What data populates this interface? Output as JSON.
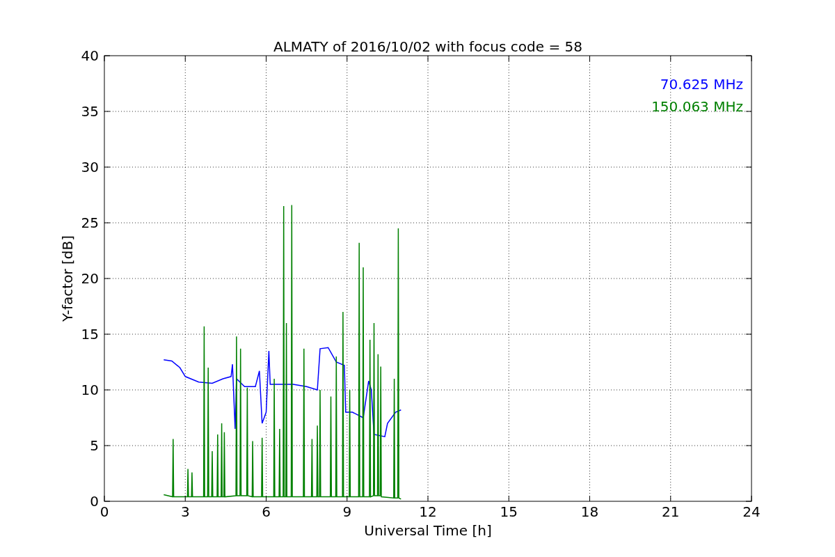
{
  "figure": {
    "chart_data": {
      "type": "line",
      "title": "ALMATY of 2016/10/02 with focus code = 58",
      "xlabel": "Universal Time [h]",
      "ylabel": "Y-factor [dB]",
      "xlim": [
        0,
        24
      ],
      "ylim": [
        0,
        40
      ],
      "xticks": [
        0,
        3,
        6,
        9,
        12,
        15,
        18,
        21,
        24
      ],
      "yticks": [
        0,
        5,
        10,
        15,
        20,
        25,
        30,
        35,
        40
      ],
      "grid": true,
      "series": [
        {
          "name": "70.625 MHz",
          "color": "#0000ff",
          "x": [
            2.2,
            2.5,
            2.8,
            3.0,
            3.5,
            4.0,
            4.4,
            4.7,
            4.75,
            4.85,
            4.9,
            5.2,
            5.6,
            5.75,
            5.85,
            6.0,
            6.1,
            6.15,
            6.5,
            7.0,
            7.5,
            7.9,
            8.0,
            8.3,
            8.6,
            8.9,
            8.95,
            9.2,
            9.6,
            9.8,
            9.9,
            10.0,
            10.4,
            10.5,
            10.8,
            11.0
          ],
          "values": [
            12.7,
            12.6,
            12.0,
            11.2,
            10.7,
            10.6,
            11.0,
            11.2,
            12.3,
            6.5,
            11.0,
            10.3,
            10.3,
            11.7,
            7.0,
            8.0,
            13.5,
            10.5,
            10.5,
            10.5,
            10.3,
            10.0,
            13.7,
            13.8,
            12.5,
            12.2,
            8.0,
            8.0,
            7.5,
            10.8,
            10.0,
            6.0,
            5.8,
            7.0,
            8.0,
            8.2
          ]
        },
        {
          "name": "150.063 MHz",
          "color": "#008000",
          "x": [
            2.2,
            2.53,
            2.55,
            2.57,
            3.08,
            3.1,
            3.12,
            3.23,
            3.25,
            3.27,
            3.68,
            3.7,
            3.72,
            3.83,
            3.85,
            3.87,
            3.98,
            4.0,
            4.02,
            4.18,
            4.2,
            4.22,
            4.33,
            4.35,
            4.37,
            4.43,
            4.45,
            4.47,
            4.88,
            4.9,
            4.92,
            5.03,
            5.05,
            5.07,
            5.28,
            5.3,
            5.32,
            5.48,
            5.5,
            5.52,
            5.83,
            5.85,
            5.87,
            6.28,
            6.3,
            6.32,
            6.48,
            6.5,
            6.52,
            6.63,
            6.65,
            6.67,
            6.73,
            6.75,
            6.77,
            6.93,
            6.95,
            6.97,
            7.38,
            7.4,
            7.42,
            7.68,
            7.7,
            7.72,
            7.88,
            7.9,
            7.92,
            7.98,
            8.0,
            8.02,
            8.38,
            8.4,
            8.42,
            8.58,
            8.6,
            8.62,
            8.83,
            8.85,
            8.87,
            9.08,
            9.1,
            9.12,
            9.43,
            9.45,
            9.47,
            9.58,
            9.6,
            9.62,
            9.83,
            9.85,
            9.87,
            9.98,
            10.0,
            10.02,
            10.13,
            10.15,
            10.17,
            10.23,
            10.25,
            10.27,
            10.73,
            10.75,
            10.77,
            10.88,
            10.9,
            10.92,
            11.0
          ],
          "values": [
            0.6,
            0.4,
            5.6,
            0.4,
            0.4,
            2.9,
            0.4,
            0.4,
            2.6,
            0.4,
            0.4,
            15.7,
            0.4,
            0.4,
            12.0,
            0.4,
            0.4,
            4.5,
            0.4,
            0.4,
            6.0,
            0.4,
            0.4,
            7.0,
            0.4,
            0.4,
            6.2,
            0.4,
            0.5,
            14.8,
            0.5,
            0.5,
            13.7,
            0.5,
            0.5,
            10.2,
            0.5,
            0.4,
            5.4,
            0.4,
            0.4,
            5.7,
            0.4,
            0.4,
            11.0,
            0.4,
            0.4,
            6.5,
            0.4,
            0.4,
            26.5,
            0.4,
            0.4,
            16.0,
            0.4,
            0.4,
            26.6,
            0.4,
            0.4,
            13.7,
            0.4,
            0.4,
            5.6,
            0.4,
            0.4,
            6.8,
            0.4,
            0.4,
            10.0,
            0.4,
            0.4,
            9.4,
            0.4,
            0.4,
            13.0,
            0.4,
            0.4,
            17.0,
            0.4,
            0.4,
            10.0,
            0.4,
            0.4,
            23.2,
            0.4,
            0.4,
            21.0,
            0.4,
            0.4,
            14.5,
            0.4,
            0.5,
            16.0,
            0.5,
            0.5,
            13.2,
            0.5,
            0.5,
            12.1,
            0.4,
            0.3,
            11.0,
            0.3,
            0.3,
            24.5,
            0.3,
            0.2
          ]
        }
      ]
    }
  }
}
